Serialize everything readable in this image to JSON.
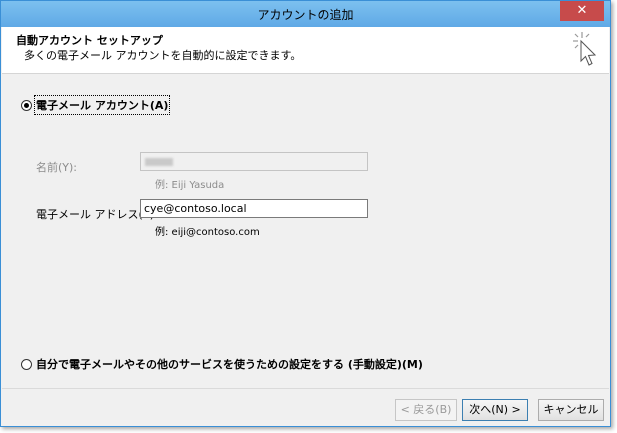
{
  "window": {
    "title": "アカウントの追加",
    "close_label": "✕"
  },
  "header": {
    "title": "自動アカウント セットアップ",
    "description": "多くの電子メール アカウントを自動的に設定できます。",
    "icon": "wizard-cursor-icon"
  },
  "options": {
    "email_account": {
      "label": "電子メール アカウント(A)",
      "selected": true
    },
    "manual_setup": {
      "label": "自分で電子メールやその他のサービスを使うための設定をする (手動設定)(M)",
      "selected": false
    }
  },
  "form": {
    "name": {
      "label": "名前(Y):",
      "value": "",
      "example": "例: Eiji Yasuda",
      "disabled": true
    },
    "email": {
      "label": "電子メール アドレス(E):",
      "value": "cye@contoso.local",
      "example": "例: eiji@contoso.com"
    }
  },
  "buttons": {
    "back": {
      "label": "< 戻る(B)",
      "disabled": true
    },
    "next": {
      "label": "次へ(N) >"
    },
    "cancel": {
      "label": "キャンセル"
    }
  }
}
